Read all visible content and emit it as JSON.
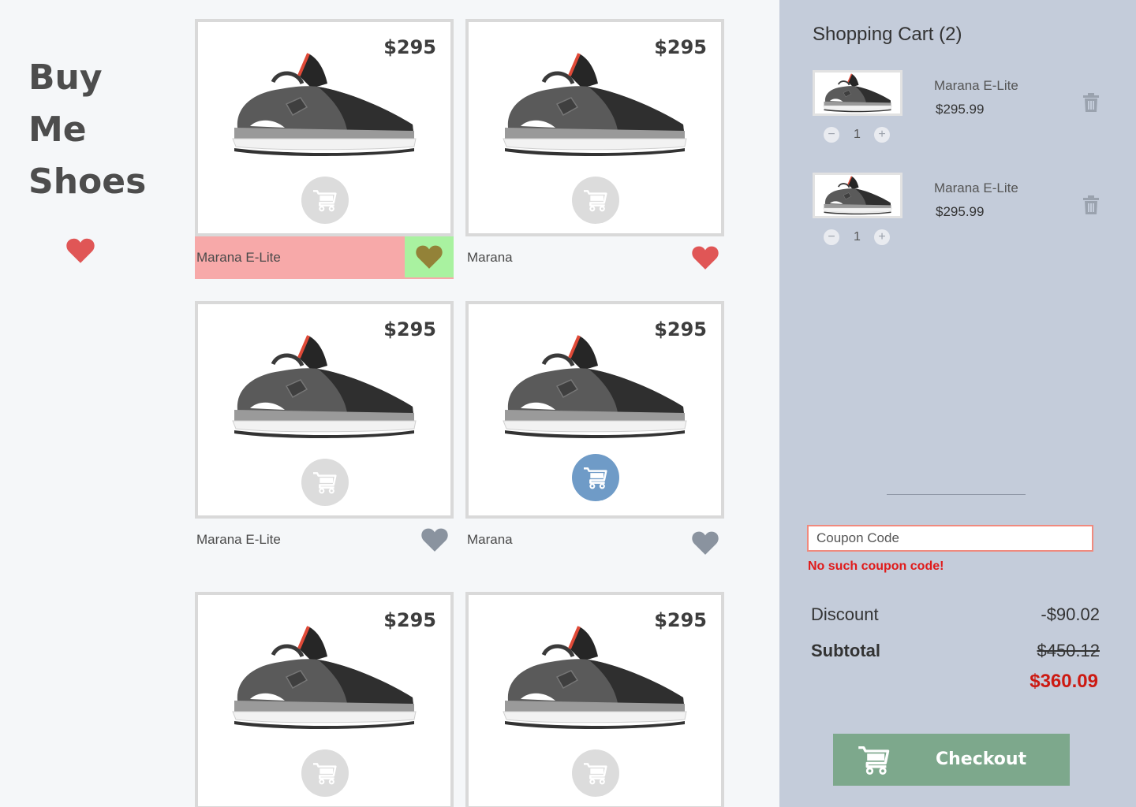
{
  "brand": {
    "line1": "Buy",
    "line2": "Me",
    "line3": "Shoes"
  },
  "colors": {
    "heart_red": "#e05656",
    "heart_gray": "#8a939f",
    "heart_olive": "#938238",
    "cart_active": "#6f9bc7",
    "checkout": "#7da88c",
    "error": "#e01b1b"
  },
  "products": [
    {
      "name": "Marana E-Lite",
      "price": "$295",
      "favorite": "highlighted",
      "in_cart": false
    },
    {
      "name": "Marana",
      "price": "$295",
      "favorite": "red",
      "in_cart": false
    },
    {
      "name": "Marana E-Lite",
      "price": "$295",
      "favorite": "gray",
      "in_cart": false
    },
    {
      "name": "Marana",
      "price": "$295",
      "favorite": "gray",
      "in_cart": true
    },
    {
      "name": "",
      "price": "$295",
      "favorite": "none",
      "in_cart": false
    },
    {
      "name": "",
      "price": "$295",
      "favorite": "none",
      "in_cart": false
    }
  ],
  "cart": {
    "title": "Shopping Cart (2)",
    "items": [
      {
        "name": "Marana E-Lite",
        "price": "$295.99",
        "qty": "1"
      },
      {
        "name": "Marana E-Lite",
        "price": "$295.99",
        "qty": "1"
      }
    ],
    "coupon_placeholder": "Coupon Code",
    "coupon_error": "No such coupon code!",
    "discount_label": "Discount",
    "discount_value": "-$90.02",
    "subtotal_label": "Subtotal",
    "subtotal_value": "$450.12",
    "total": "$360.09",
    "checkout_label": "Checkout"
  },
  "icons": {
    "heart": "heart-icon",
    "cart": "shopping-cart-icon",
    "trash": "trash-icon",
    "minus": "minus-icon",
    "plus": "plus-icon"
  }
}
